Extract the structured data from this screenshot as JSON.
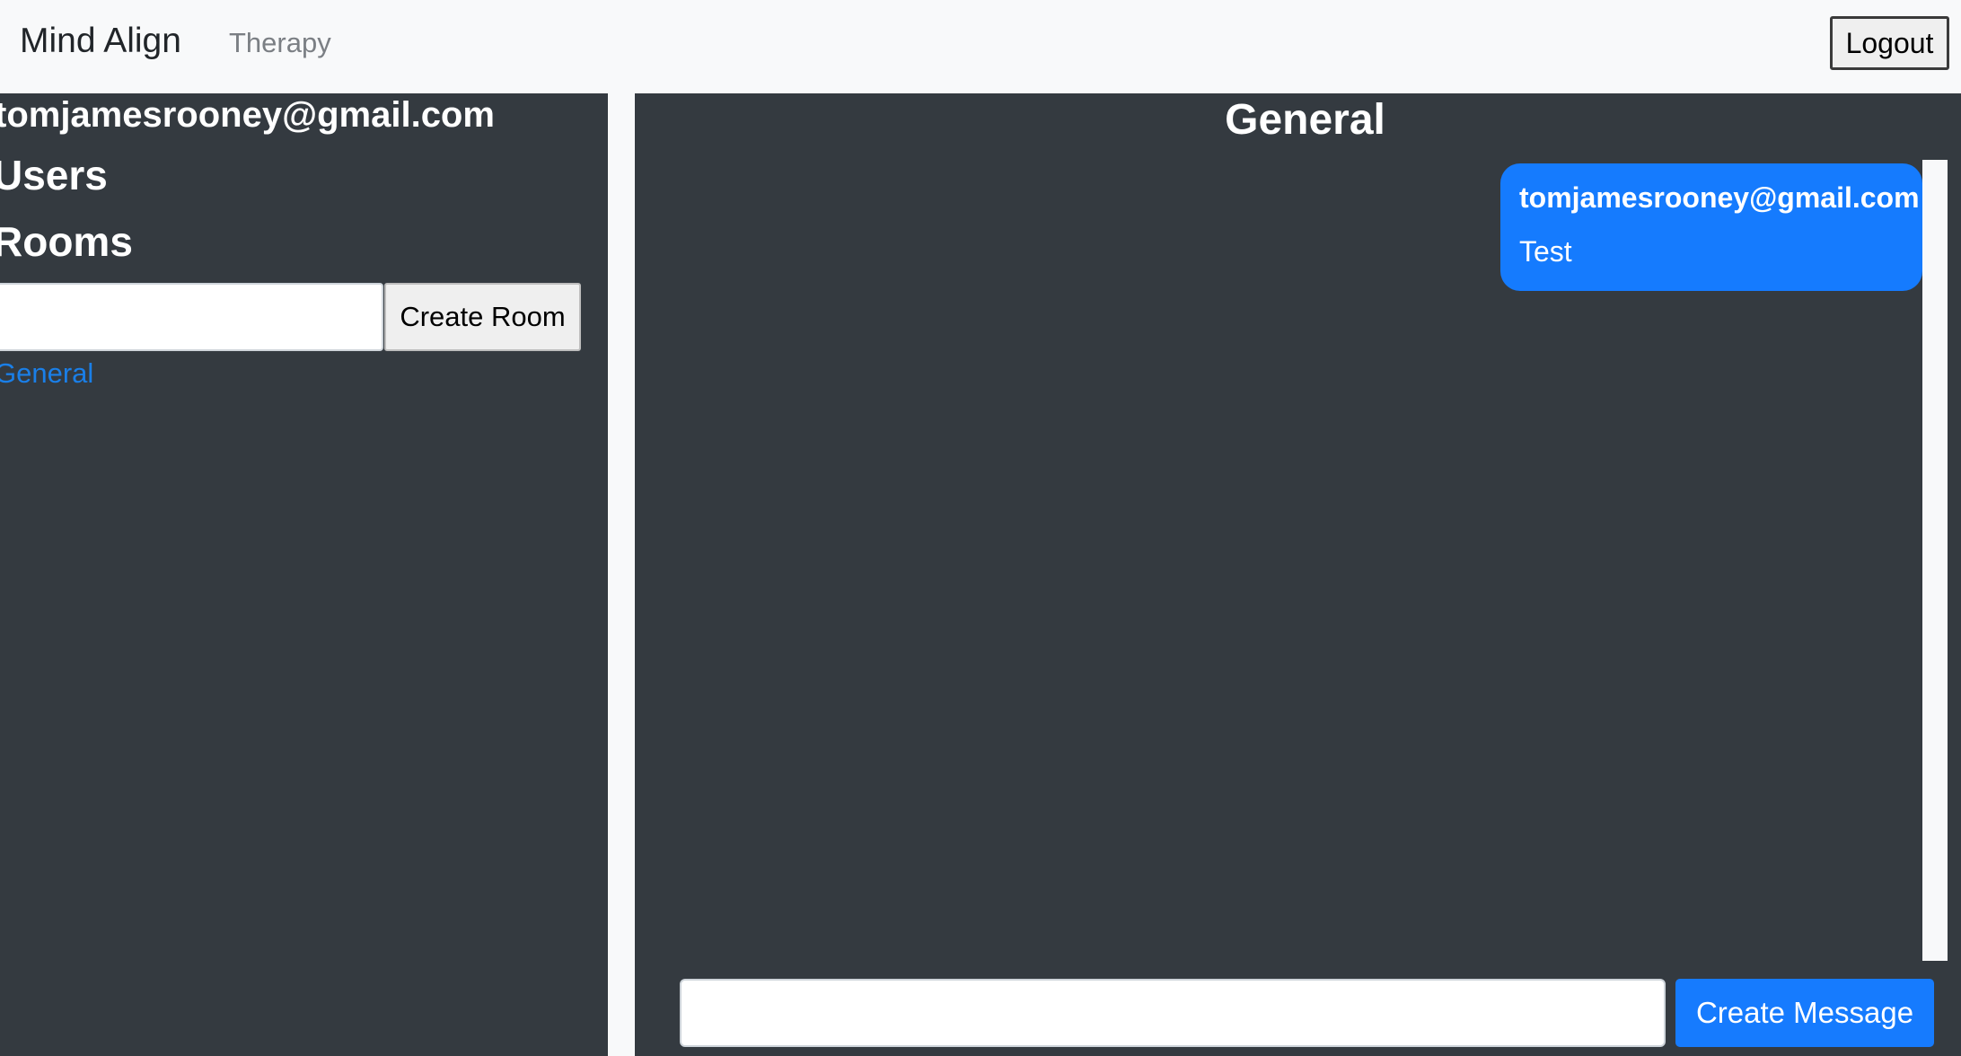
{
  "navbar": {
    "brand": "Mind Align",
    "link": "Therapy",
    "logout_label": "Logout"
  },
  "sidebar": {
    "user_email": "tomjamesrooney@gmail.com",
    "users_heading": "Users",
    "rooms_heading": "Rooms",
    "room_input_value": "",
    "create_room_label": "Create Room",
    "rooms": [
      {
        "label": "General"
      }
    ]
  },
  "chat": {
    "title": "General",
    "messages": [
      {
        "sender": "tomjamesrooney@gmail.com",
        "text": "Test"
      }
    ],
    "message_input_value": "",
    "create_message_label": "Create Message"
  },
  "colors": {
    "panel": "#343a40",
    "accent": "#157bfe",
    "link": "#1a7fe8",
    "background": "#f8f9fa"
  }
}
